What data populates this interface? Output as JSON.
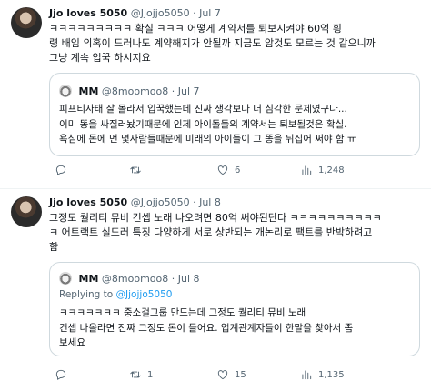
{
  "tweets": [
    {
      "author": "Jjo loves 5050",
      "handle": "@Jjojjo5050",
      "dot": "·",
      "date": "Jul 7",
      "text_lines": [
        "ㅋㅋㅋㅋㅋㅋㅋㅋㅋ 확실 ㅋㅋㅋ 어떻게 계약서를 퇴보시켜야 60억 횡",
        "령 배임 의혹이 드러나도 계약해지가 안될까 지금도 암것도 모르는 것 같으니까",
        "그냥 계속 입꾹 하시지요"
      ],
      "quote": {
        "author": "MM",
        "handle": "@8moomoo8",
        "dot": "·",
        "date": "Jul 7",
        "reply_prefix": "",
        "reply_handle": "",
        "text_lines": [
          "피프티사태 잘 몰라서 입꾹했는데 진짜 생각보다 더 심각한 문제였구나...",
          "이미 똥을 싸질러놨기때문에 인제 아이돌들의 계약서는 퇴보될것은 확실.",
          "욕심에 돈에 먼 몇사람들때문에 미래의 아이들이 그 똥을 뒤집어 써야 함 ㅠ"
        ]
      },
      "actions": {
        "replies": "",
        "retweets": "",
        "likes": "6",
        "views": "1,248"
      }
    },
    {
      "author": "Jjo loves 5050",
      "handle": "@Jjojjo5050",
      "dot": "·",
      "date": "Jul 8",
      "text_lines": [
        "그정도 퀄리티 뮤비 컨셉 노래 나오려면 80억 써야된단다 ㅋㅋㅋㅋㅋㅋㅋㅋㅋㅋ",
        "ㅋ 어트랙트 실드러 특징 다양하게 서로 상반되는 개논리로 팩트를 반박하려고",
        "함"
      ],
      "quote": {
        "author": "MM",
        "handle": "@8moomoo8",
        "dot": "·",
        "date": "Jul 8",
        "reply_prefix": "Replying to ",
        "reply_handle": "@Jjojjo5050",
        "text_lines": [
          "ㅋㅋㅋㅋㅋㅋㅋ 중소걸그룹 만드는데 그정도 퀄리티 뮤비 노래",
          "컨셉 나올라면 진짜 그정도 돈이 들어요. 업계관계자들이 한말을 찾아서 좀",
          "보세요"
        ]
      },
      "actions": {
        "replies": "",
        "retweets": "1",
        "likes": "15",
        "views": "1,135"
      }
    }
  ],
  "icons": [
    "reply-icon",
    "retweet-icon",
    "like-icon",
    "views-icon"
  ],
  "colors": {
    "text": "#0f1419",
    "secondary": "#536471",
    "link": "#1d9bf0",
    "border": "#cfd9de"
  }
}
